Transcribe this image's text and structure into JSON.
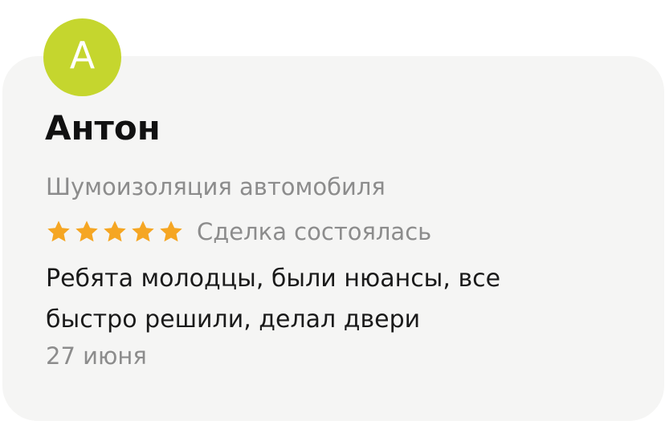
{
  "review": {
    "avatar_letter": "А",
    "avatar_color": "#c5d62e",
    "author_name": "Антон",
    "service": "Шумоизоляция автомобиля",
    "rating": 5,
    "rating_max": 5,
    "star_color": "#f5a623",
    "deal_status": "Сделка состоялась",
    "text_line_1": "Ребята молодцы, были нюансы, все",
    "text_line_2": "быстро решили, делал двери",
    "date": "27 июня"
  }
}
